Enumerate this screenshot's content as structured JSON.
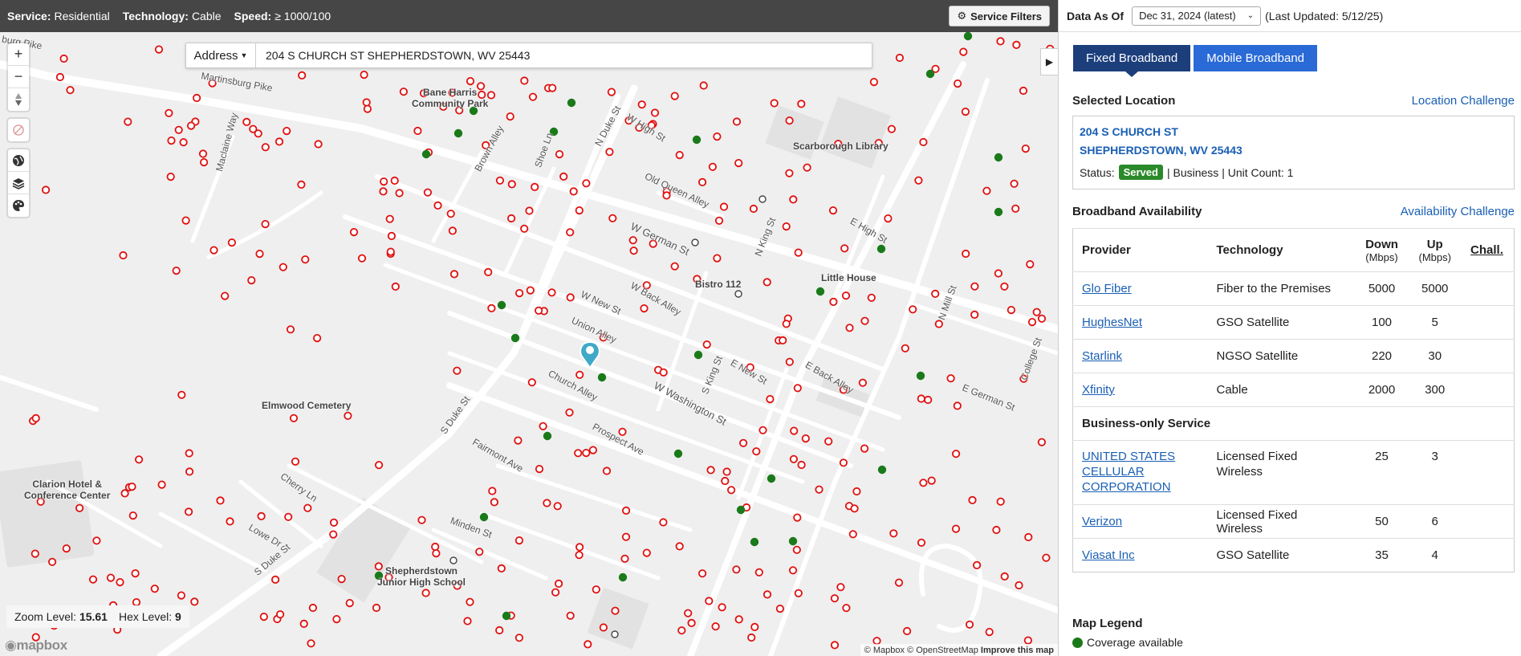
{
  "topbar": {
    "service_label": "Service:",
    "service_value": "Residential",
    "technology_label": "Technology:",
    "technology_value": "Cable",
    "speed_label": "Speed:",
    "speed_value": "≥ 1000/100",
    "service_filters_button": "Service Filters"
  },
  "search": {
    "type_dropdown": "Address",
    "value": "204 S CHURCH ST SHEPHERDSTOWN, WV 25443"
  },
  "map": {
    "labels": {
      "martinsburg_pike": "Martinsburg Pike",
      "burg_pike": "burg Pike",
      "maclaine_way": "Maclaine Way",
      "bane_harris": "Bane Harris",
      "community_park": "Community Park",
      "brown_alley": "Brown Alley",
      "shoe_ln": "Shoe Ln",
      "n_duke_st": "N Duke St",
      "w_high_st": "W High St",
      "old_queen_alley": "Old Queen Alley",
      "scarborough_library": "Scarborough Library",
      "w_german_st": "W German St",
      "n_king_st": "N King St",
      "e_high_st": "E High St",
      "bistro_112": "Bistro 112",
      "little_house": "Little House",
      "w_back_alley": "W Back Alley",
      "w_new_st": "W New St",
      "union_alley": "Union Alley",
      "n_mill_st": "N Mill St",
      "s_king_st": "S King St",
      "e_new_st": "E New St",
      "e_back_alley": "E Back Alley",
      "college_st": "College St",
      "church_alley": "Church Alley",
      "w_washington_st": "W Washington St",
      "e_german_st": "E German St",
      "elmwood_cemetery": "Elmwood Cemetery",
      "s_duke_st": "S Duke St",
      "prospect_ave": "Prospect Ave",
      "fairmont_ave": "Fairmont Ave",
      "clarion_hotel_1": "Clarion Hotel &",
      "clarion_hotel_2": "Conference Center",
      "cherry_ln": "Cherry Ln",
      "lowe_dr": "Lowe Dr",
      "minden_st": "Minden St",
      "s_duke_st_2": "S Duke St",
      "shepherdstown_1": "Shepherdstown",
      "shepherdstown_2": "Junior High School"
    },
    "zoom_label": "Zoom Level:",
    "zoom_value": "15.61",
    "hex_label": "Hex Level:",
    "hex_value": "9",
    "logo": "mapbox",
    "attribution": {
      "mapbox": "© Mapbox",
      "osm": "© OpenStreetMap",
      "improve": "Improve this map"
    },
    "colors": {
      "covered": "#1a7a1a",
      "not_covered": "#e01010",
      "other": "#444444",
      "pin": "#3fa9c8"
    }
  },
  "panel": {
    "data_as_of_label": "Data As Of",
    "data_as_of_value": "Dec 31, 2024 (latest)",
    "last_updated": "(Last Updated: 5/12/25)",
    "tabs": [
      {
        "label": "Fixed Broadband",
        "active": true
      },
      {
        "label": "Mobile Broadband",
        "active": false
      }
    ],
    "selected_location_title": "Selected Location",
    "location_challenge_link": "Location Challenge",
    "location": {
      "address_line1": "204 S CHURCH ST",
      "address_line2": "SHEPHERDSTOWN, WV 25443",
      "status_label": "Status:",
      "status_value": "Served",
      "details": "| Business | Unit Count: 1"
    },
    "availability_title": "Broadband Availability",
    "availability_challenge_link": "Availability Challenge",
    "table": {
      "headers": {
        "provider": "Provider",
        "technology": "Technology",
        "down": "Down",
        "down_unit": "(Mbps)",
        "up": "Up",
        "up_unit": "(Mbps)",
        "challenge": "Chall."
      },
      "rows": [
        {
          "provider": "Glo Fiber",
          "technology": "Fiber to the Premises",
          "down": "5000",
          "up": "5000"
        },
        {
          "provider": "HughesNet",
          "technology": "GSO Satellite",
          "down": "100",
          "up": "5"
        },
        {
          "provider": "Starlink",
          "technology": "NGSO Satellite",
          "down": "220",
          "up": "30"
        },
        {
          "provider": "Xfinity",
          "technology": "Cable",
          "down": "2000",
          "up": "300"
        }
      ],
      "business_only_title": "Business-only Service",
      "business_rows": [
        {
          "provider": "UNITED STATES CELLULAR CORPORATION",
          "technology": "Licensed Fixed Wireless",
          "down": "25",
          "up": "3"
        },
        {
          "provider": "Verizon",
          "technology": "Licensed Fixed Wireless",
          "down": "50",
          "up": "6"
        },
        {
          "provider": "Viasat Inc",
          "technology": "GSO Satellite",
          "down": "35",
          "up": "4"
        }
      ]
    },
    "legend_title": "Map Legend",
    "legend_item": "Coverage available"
  }
}
